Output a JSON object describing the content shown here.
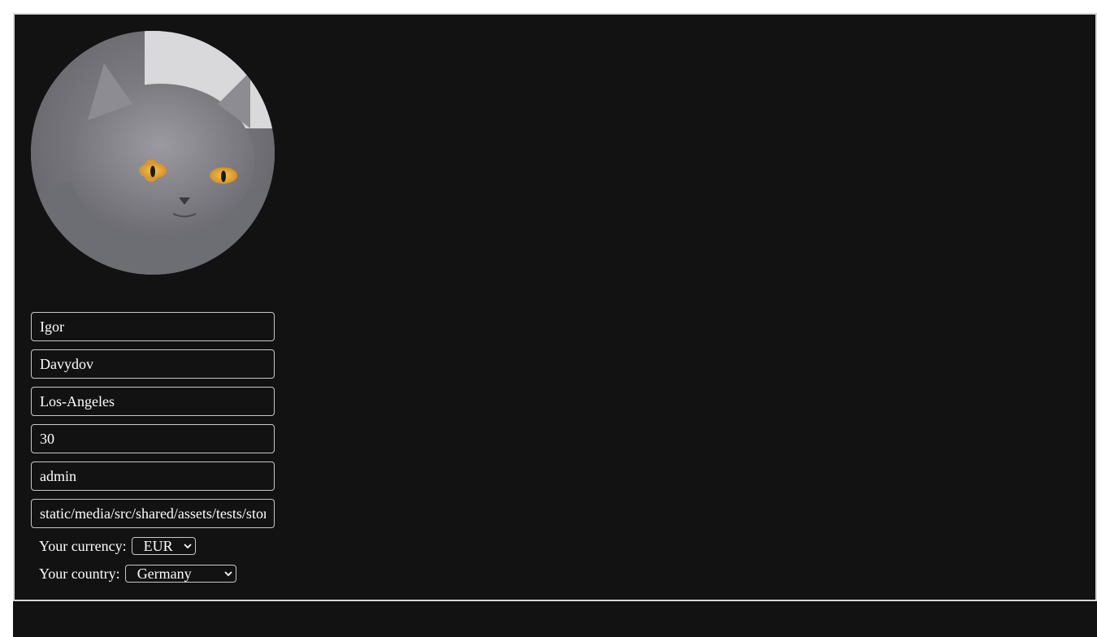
{
  "profile": {
    "avatar_alt": "cat-photo",
    "first_name": "Igor",
    "last_name": "Davydov",
    "city": "Los-Angeles",
    "age": "30",
    "role": "admin",
    "avatar_path": "static/media/src/shared/assets/tests/stor"
  },
  "settings": {
    "currency_label": "Your currency:",
    "currency_value": "EUR",
    "country_label": "Your country:",
    "country_value": "Germany"
  },
  "icons": {
    "select_arrow": "chevron-down-icon"
  },
  "colors": {
    "card_background": "#121212",
    "text": "#ffffff",
    "border": "#c8c8c8"
  }
}
